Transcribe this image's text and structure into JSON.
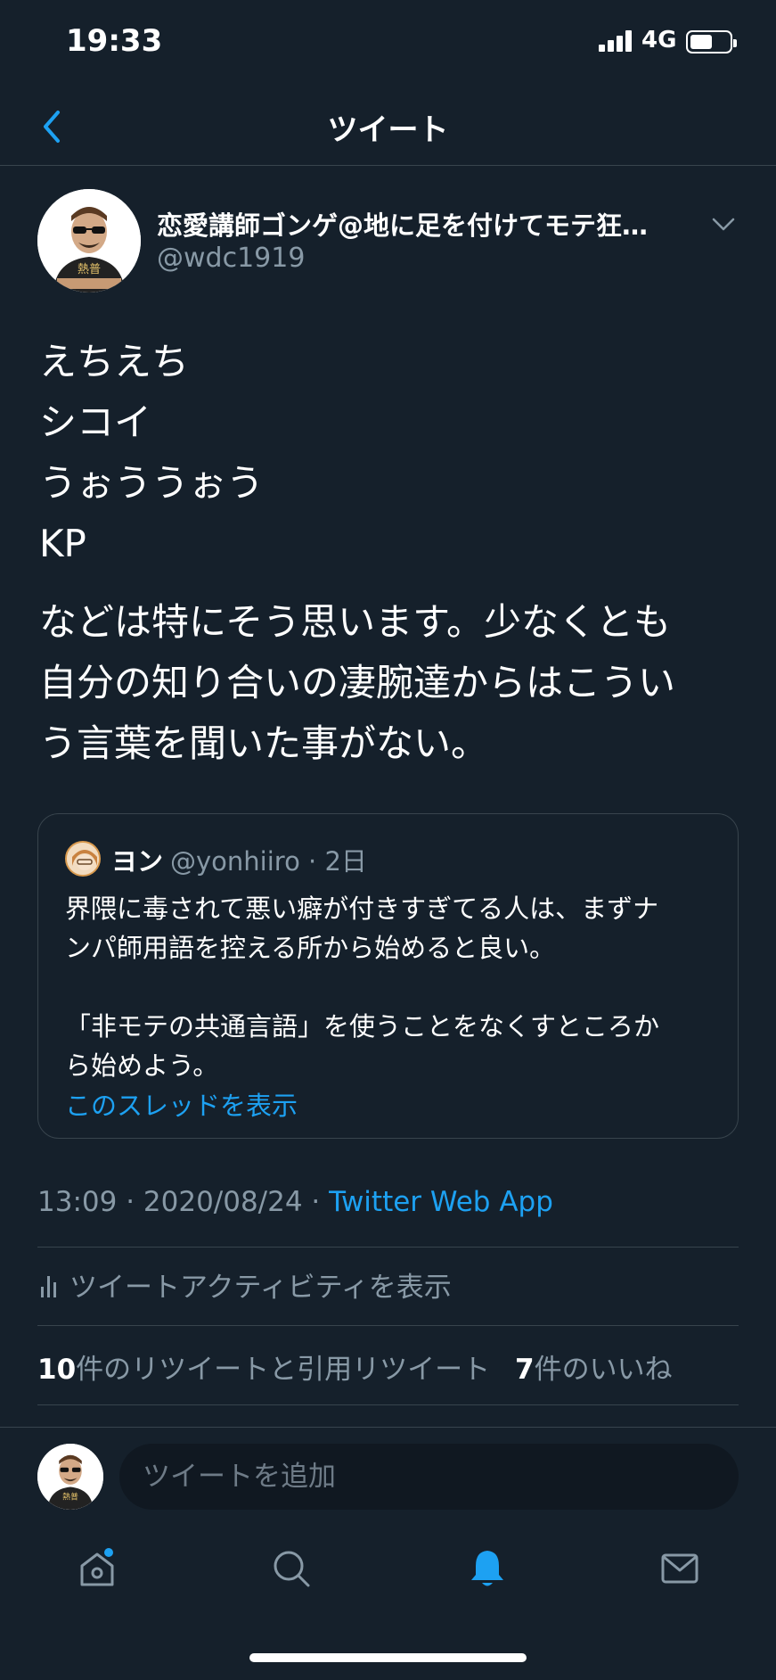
{
  "status_bar": {
    "time": "19:33",
    "network": "4G",
    "battery_level": 0.55
  },
  "header": {
    "title": "ツイート"
  },
  "tweet": {
    "author": {
      "display_name": "恋愛講師ゴンゲ@地に足を付けてモテ狂…",
      "handle": "@wdc1919",
      "avatar_label": "熱普"
    },
    "lines": [
      "えちえち",
      "シコイ",
      "うぉううぉう",
      "KP"
    ],
    "paragraph_lines": [
      "などは特にそう思います。少なくとも",
      "自分の知り合いの凄腕達からはこうい",
      "う言葉を聞いた事がない。"
    ],
    "quote": {
      "name": "ヨン",
      "handle_time": "@yonhiiro · 2日",
      "text_lines_1": [
        "界隈に毒されて悪い癖が付きすぎてる人は、まずナ",
        "ンパ師用語を控える所から始めると良い。"
      ],
      "text_lines_2": [
        "「非モテの共通言語」を使うことをなくすところか",
        "ら始めよう。"
      ],
      "show_thread": "このスレッドを表示"
    },
    "timestamp": "13:09 · 2020/08/24 · ",
    "source": "Twitter Web App",
    "activity_label": "ツイートアクティビティを表示",
    "retweet_count": "10",
    "retweet_label": "件のリツイートと引用リツイート",
    "like_count": "7",
    "like_label": "件のいいね"
  },
  "reply": {
    "placeholder": "ツイートを追加"
  },
  "tabs": [
    {
      "icon": "home-icon",
      "badge": true
    },
    {
      "icon": "search-icon"
    },
    {
      "icon": "bell-icon",
      "active": true
    },
    {
      "icon": "mail-icon"
    }
  ],
  "colors": {
    "background": "#15202b",
    "accent": "#1da1f2",
    "secondary_text": "#8899a6",
    "border": "#38444d"
  }
}
